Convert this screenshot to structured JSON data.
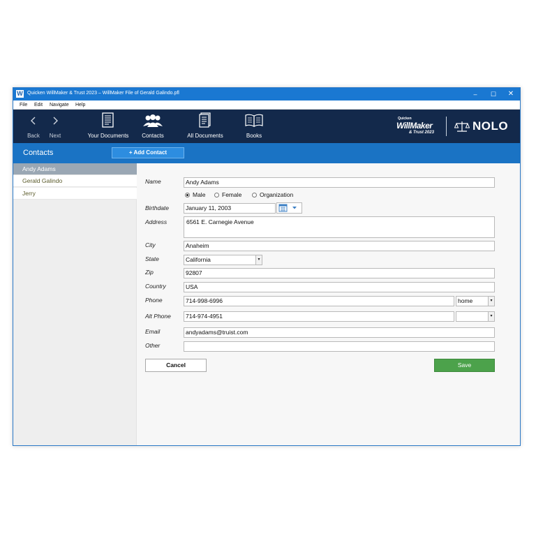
{
  "window": {
    "app_icon": "W",
    "title": "Quicken WillMaker & Trust 2023 – WillMaker File of Gerald Galindo.pfl",
    "controls": {
      "minimize": "–",
      "maximize": "☐",
      "close": "✕"
    }
  },
  "menu": {
    "file": "File",
    "edit": "Edit",
    "navigate": "Navigate",
    "help": "Help"
  },
  "toolbar": {
    "back": "Back",
    "next": "Next",
    "your_documents": "Your Documents",
    "contacts": "Contacts",
    "all_documents": "All Documents",
    "books": "Books"
  },
  "brand": {
    "quicken": "Quicken",
    "willmaker": "WillMaker",
    "trust": "& Trust 2023",
    "nolo": "NOLO"
  },
  "header": {
    "title": "Contacts",
    "add_button": "+ Add Contact"
  },
  "sidebar": {
    "items": [
      {
        "label": "Andy Adams",
        "selected": true
      },
      {
        "label": "Gerald Galindo",
        "selected": false
      },
      {
        "label": "Jerry",
        "selected": false
      }
    ]
  },
  "form": {
    "name_label": "Name",
    "name_value": "Andy Adams",
    "gender": {
      "male": "Male",
      "female": "Female",
      "organization": "Organization",
      "selected": "Male"
    },
    "birthdate_label": "Birthdate",
    "birthdate_value": "January 11, 2003",
    "address_label": "Address",
    "address_value": "6561 E. Carnegie Avenue",
    "city_label": "City",
    "city_value": "Anaheim",
    "state_label": "State",
    "state_value": "California",
    "zip_label": "Zip",
    "zip_value": "92807",
    "country_label": "Country",
    "country_value": "USA",
    "phone_label": "Phone",
    "phone_value": "714-998-6996",
    "phone_type": "home",
    "alt_phone_label": "Alt Phone",
    "alt_phone_value": "714-974-4951",
    "alt_phone_type": "",
    "email_label": "Email",
    "email_value": "andyadams@truist.com",
    "other_label": "Other",
    "other_value": ""
  },
  "buttons": {
    "cancel": "Cancel",
    "save": "Save"
  },
  "colors": {
    "titlebar": "#1a78d2",
    "toolbar": "#13294b",
    "accent_bar": "#1a73c4",
    "save": "#4ca24b",
    "selected_item": "#9aa7b4"
  }
}
